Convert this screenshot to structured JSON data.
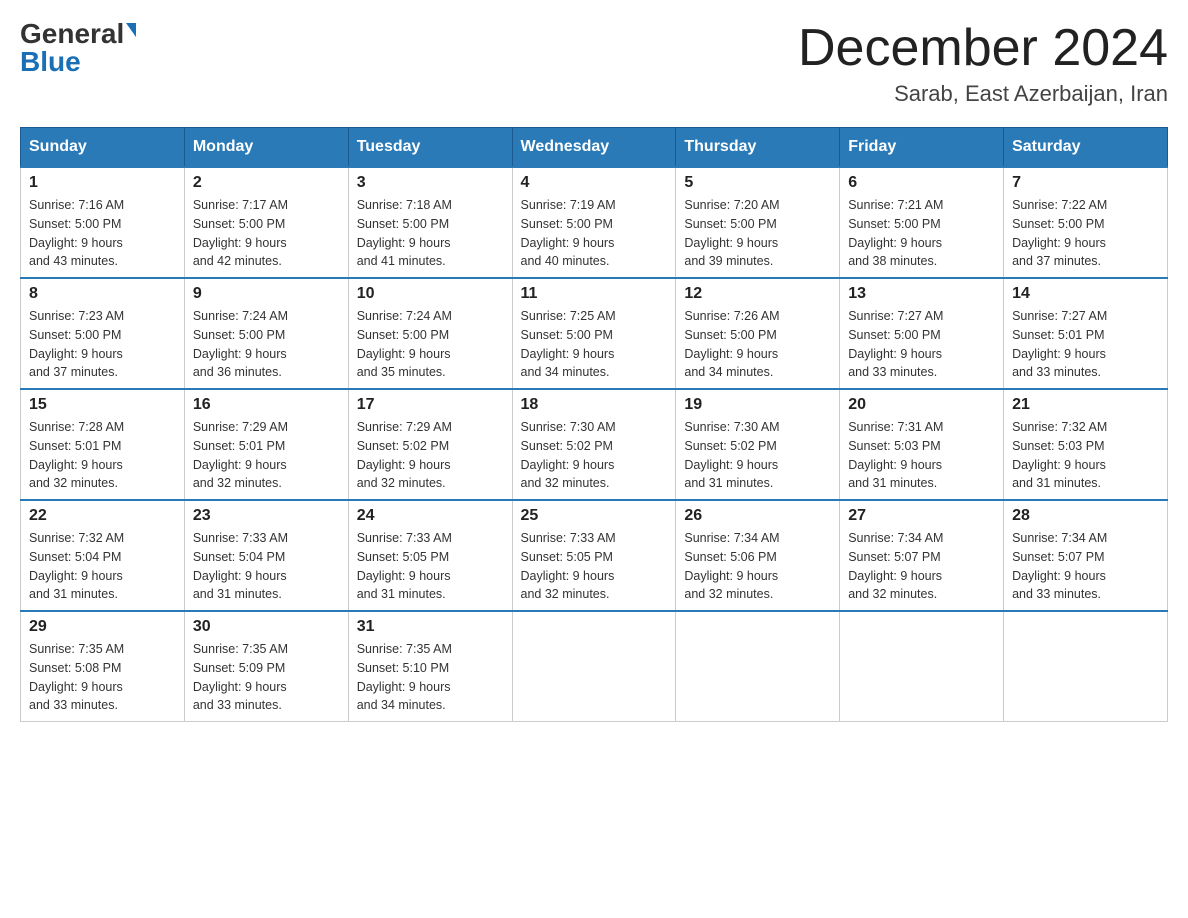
{
  "header": {
    "logo_general": "General",
    "logo_blue": "Blue",
    "title": "December 2024",
    "subtitle": "Sarab, East Azerbaijan, Iran"
  },
  "days_of_week": [
    "Sunday",
    "Monday",
    "Tuesday",
    "Wednesday",
    "Thursday",
    "Friday",
    "Saturday"
  ],
  "weeks": [
    [
      {
        "day": "1",
        "sunrise": "7:16 AM",
        "sunset": "5:00 PM",
        "daylight": "9 hours and 43 minutes."
      },
      {
        "day": "2",
        "sunrise": "7:17 AM",
        "sunset": "5:00 PM",
        "daylight": "9 hours and 42 minutes."
      },
      {
        "day": "3",
        "sunrise": "7:18 AM",
        "sunset": "5:00 PM",
        "daylight": "9 hours and 41 minutes."
      },
      {
        "day": "4",
        "sunrise": "7:19 AM",
        "sunset": "5:00 PM",
        "daylight": "9 hours and 40 minutes."
      },
      {
        "day": "5",
        "sunrise": "7:20 AM",
        "sunset": "5:00 PM",
        "daylight": "9 hours and 39 minutes."
      },
      {
        "day": "6",
        "sunrise": "7:21 AM",
        "sunset": "5:00 PM",
        "daylight": "9 hours and 38 minutes."
      },
      {
        "day": "7",
        "sunrise": "7:22 AM",
        "sunset": "5:00 PM",
        "daylight": "9 hours and 37 minutes."
      }
    ],
    [
      {
        "day": "8",
        "sunrise": "7:23 AM",
        "sunset": "5:00 PM",
        "daylight": "9 hours and 37 minutes."
      },
      {
        "day": "9",
        "sunrise": "7:24 AM",
        "sunset": "5:00 PM",
        "daylight": "9 hours and 36 minutes."
      },
      {
        "day": "10",
        "sunrise": "7:24 AM",
        "sunset": "5:00 PM",
        "daylight": "9 hours and 35 minutes."
      },
      {
        "day": "11",
        "sunrise": "7:25 AM",
        "sunset": "5:00 PM",
        "daylight": "9 hours and 34 minutes."
      },
      {
        "day": "12",
        "sunrise": "7:26 AM",
        "sunset": "5:00 PM",
        "daylight": "9 hours and 34 minutes."
      },
      {
        "day": "13",
        "sunrise": "7:27 AM",
        "sunset": "5:00 PM",
        "daylight": "9 hours and 33 minutes."
      },
      {
        "day": "14",
        "sunrise": "7:27 AM",
        "sunset": "5:01 PM",
        "daylight": "9 hours and 33 minutes."
      }
    ],
    [
      {
        "day": "15",
        "sunrise": "7:28 AM",
        "sunset": "5:01 PM",
        "daylight": "9 hours and 32 minutes."
      },
      {
        "day": "16",
        "sunrise": "7:29 AM",
        "sunset": "5:01 PM",
        "daylight": "9 hours and 32 minutes."
      },
      {
        "day": "17",
        "sunrise": "7:29 AM",
        "sunset": "5:02 PM",
        "daylight": "9 hours and 32 minutes."
      },
      {
        "day": "18",
        "sunrise": "7:30 AM",
        "sunset": "5:02 PM",
        "daylight": "9 hours and 32 minutes."
      },
      {
        "day": "19",
        "sunrise": "7:30 AM",
        "sunset": "5:02 PM",
        "daylight": "9 hours and 31 minutes."
      },
      {
        "day": "20",
        "sunrise": "7:31 AM",
        "sunset": "5:03 PM",
        "daylight": "9 hours and 31 minutes."
      },
      {
        "day": "21",
        "sunrise": "7:32 AM",
        "sunset": "5:03 PM",
        "daylight": "9 hours and 31 minutes."
      }
    ],
    [
      {
        "day": "22",
        "sunrise": "7:32 AM",
        "sunset": "5:04 PM",
        "daylight": "9 hours and 31 minutes."
      },
      {
        "day": "23",
        "sunrise": "7:33 AM",
        "sunset": "5:04 PM",
        "daylight": "9 hours and 31 minutes."
      },
      {
        "day": "24",
        "sunrise": "7:33 AM",
        "sunset": "5:05 PM",
        "daylight": "9 hours and 31 minutes."
      },
      {
        "day": "25",
        "sunrise": "7:33 AM",
        "sunset": "5:05 PM",
        "daylight": "9 hours and 32 minutes."
      },
      {
        "day": "26",
        "sunrise": "7:34 AM",
        "sunset": "5:06 PM",
        "daylight": "9 hours and 32 minutes."
      },
      {
        "day": "27",
        "sunrise": "7:34 AM",
        "sunset": "5:07 PM",
        "daylight": "9 hours and 32 minutes."
      },
      {
        "day": "28",
        "sunrise": "7:34 AM",
        "sunset": "5:07 PM",
        "daylight": "9 hours and 33 minutes."
      }
    ],
    [
      {
        "day": "29",
        "sunrise": "7:35 AM",
        "sunset": "5:08 PM",
        "daylight": "9 hours and 33 minutes."
      },
      {
        "day": "30",
        "sunrise": "7:35 AM",
        "sunset": "5:09 PM",
        "daylight": "9 hours and 33 minutes."
      },
      {
        "day": "31",
        "sunrise": "7:35 AM",
        "sunset": "5:10 PM",
        "daylight": "9 hours and 34 minutes."
      },
      null,
      null,
      null,
      null
    ]
  ],
  "labels": {
    "sunrise": "Sunrise:",
    "sunset": "Sunset:",
    "daylight": "Daylight:"
  }
}
